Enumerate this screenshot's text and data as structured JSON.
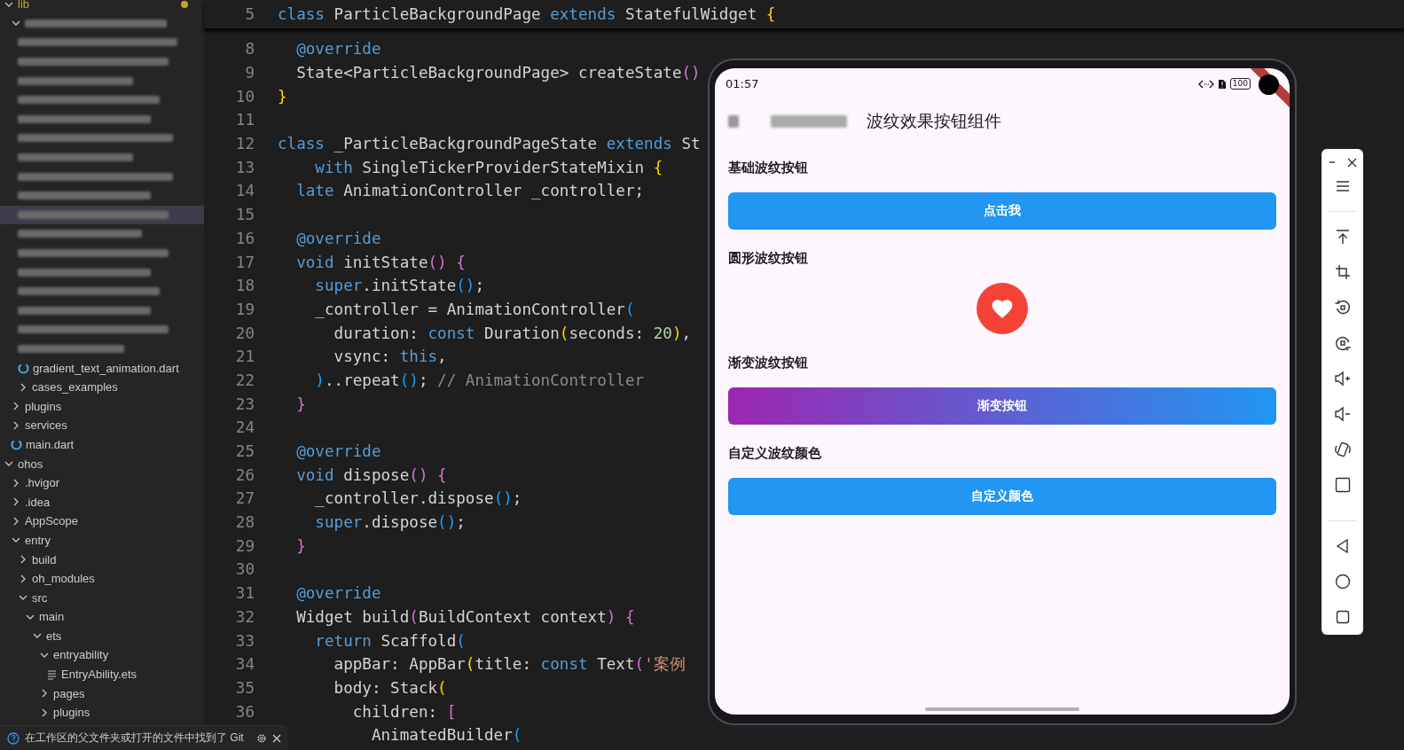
{
  "explorer": {
    "tree": [
      {
        "kind": "folder",
        "label": "lib",
        "expanded": true,
        "selected": false,
        "color": "#c9a22a",
        "children": [
          {
            "kind": "redacted",
            "expanded": true,
            "selected": false,
            "children": [
              {
                "kind": "redacted",
                "selected": false
              },
              {
                "kind": "redacted",
                "selected": false
              },
              {
                "kind": "redacted",
                "selected": false
              },
              {
                "kind": "redacted",
                "selected": false
              },
              {
                "kind": "redacted",
                "selected": false
              },
              {
                "kind": "redacted",
                "selected": false
              },
              {
                "kind": "redacted",
                "selected": false
              },
              {
                "kind": "redacted",
                "selected": false
              },
              {
                "kind": "redacted",
                "selected": false
              },
              {
                "kind": "redacted",
                "selected": true
              },
              {
                "kind": "redacted",
                "selected": false
              },
              {
                "kind": "redacted",
                "selected": false
              },
              {
                "kind": "redacted",
                "selected": false
              },
              {
                "kind": "redacted",
                "selected": false
              },
              {
                "kind": "redacted",
                "selected": false
              },
              {
                "kind": "redacted",
                "selected": false
              },
              {
                "kind": "redacted",
                "selected": false
              },
              {
                "kind": "dart",
                "label": "gradient_text_animation.dart",
                "selected": false
              },
              {
                "kind": "folder",
                "label": "cases_examples",
                "expanded": false,
                "selected": false
              }
            ]
          },
          {
            "kind": "folder",
            "label": "plugins",
            "expanded": false,
            "selected": false
          },
          {
            "kind": "folder",
            "label": "services",
            "expanded": false,
            "selected": false
          },
          {
            "kind": "dart",
            "label": "main.dart",
            "selected": false
          }
        ]
      },
      {
        "kind": "folder",
        "label": "ohos",
        "expanded": true,
        "selected": false,
        "children": [
          {
            "kind": "folder",
            "label": ".hvigor",
            "expanded": false,
            "selected": false
          },
          {
            "kind": "folder",
            "label": ".idea",
            "expanded": false,
            "selected": false
          },
          {
            "kind": "folder",
            "label": "AppScope",
            "expanded": false,
            "selected": false
          },
          {
            "kind": "folder",
            "label": "entry",
            "expanded": true,
            "selected": false,
            "children": [
              {
                "kind": "folder",
                "label": "build",
                "expanded": false,
                "selected": false
              },
              {
                "kind": "folder",
                "label": "oh_modules",
                "expanded": false,
                "selected": false
              },
              {
                "kind": "folder",
                "label": "src",
                "expanded": true,
                "selected": false,
                "children": [
                  {
                    "kind": "folder",
                    "label": "main",
                    "expanded": true,
                    "selected": false,
                    "children": [
                      {
                        "kind": "folder",
                        "label": "ets",
                        "expanded": true,
                        "selected": false,
                        "children": [
                          {
                            "kind": "folder",
                            "label": "entryability",
                            "expanded": true,
                            "selected": false,
                            "children": [
                              {
                                "kind": "text",
                                "label": "EntryAbility.ets",
                                "selected": false
                              }
                            ]
                          },
                          {
                            "kind": "folder",
                            "label": "pages",
                            "expanded": false,
                            "selected": false
                          },
                          {
                            "kind": "folder",
                            "label": "plugins",
                            "expanded": false,
                            "selected": false
                          }
                        ]
                      }
                    ]
                  }
                ]
              }
            ]
          }
        ]
      }
    ]
  },
  "notification": {
    "text": "在工作区的父文件夹或打开的文件中找到了 Git"
  },
  "editor": {
    "sticky": {
      "number": "5",
      "tokens": [
        {
          "kind": "kw",
          "text": "class"
        },
        {
          "kind": "id",
          "text": " ParticleBackgroundPage "
        },
        {
          "kind": "kw",
          "text": "extends"
        },
        {
          "kind": "id",
          "text": " StatefulWidget "
        },
        {
          "kind": "y",
          "text": "{"
        }
      ]
    },
    "lines": [
      {
        "number": "8",
        "tokens": [
          {
            "kind": "kw",
            "text": "  @override"
          }
        ]
      },
      {
        "number": "9",
        "tokens": [
          {
            "kind": "id",
            "text": "  State<ParticleBackgroundPage> createState"
          },
          {
            "kind": "p",
            "text": "()"
          }
        ]
      },
      {
        "number": "10",
        "tokens": [
          {
            "kind": "y",
            "text": "}"
          }
        ]
      },
      {
        "number": "11"
      },
      {
        "number": "12",
        "tokens": [
          {
            "kind": "kw",
            "text": "class"
          },
          {
            "kind": "id",
            "text": " _ParticleBackgroundPageState "
          },
          {
            "kind": "kw",
            "text": "extends"
          },
          {
            "kind": "id",
            "text": " St"
          }
        ]
      },
      {
        "number": "13",
        "tokens": [
          {
            "kind": "kw",
            "text": "    with"
          },
          {
            "kind": "id",
            "text": " SingleTickerProviderStateMixin "
          },
          {
            "kind": "y",
            "text": "{"
          }
        ]
      },
      {
        "number": "14",
        "tokens": [
          {
            "kind": "kw",
            "text": "  late"
          },
          {
            "kind": "id",
            "text": " AnimationController _controller;"
          }
        ]
      },
      {
        "number": "15"
      },
      {
        "number": "16",
        "tokens": [
          {
            "kind": "kw",
            "text": "  @override"
          }
        ]
      },
      {
        "number": "17",
        "tokens": [
          {
            "kind": "kw",
            "text": "  void"
          },
          {
            "kind": "id",
            "text": " initState"
          },
          {
            "kind": "p",
            "text": "()"
          },
          {
            "kind": "p",
            "text": " {"
          }
        ]
      },
      {
        "number": "18",
        "tokens": [
          {
            "kind": "kw",
            "text": "    super"
          },
          {
            "kind": "id",
            "text": ".initState"
          },
          {
            "kind": "b",
            "text": "()"
          },
          {
            "kind": "id",
            "text": ";"
          }
        ]
      },
      {
        "number": "19",
        "tokens": [
          {
            "kind": "id",
            "text": "    _controller = AnimationController"
          },
          {
            "kind": "b",
            "text": "("
          }
        ]
      },
      {
        "number": "20",
        "tokens": [
          {
            "kind": "id",
            "text": "      duration: "
          },
          {
            "kind": "kw",
            "text": "const"
          },
          {
            "kind": "id",
            "text": " Duration"
          },
          {
            "kind": "y",
            "text": "("
          },
          {
            "kind": "id",
            "text": "seconds: "
          },
          {
            "kind": "num",
            "text": "20"
          },
          {
            "kind": "y",
            "text": ")"
          },
          {
            "kind": "id",
            "text": ","
          }
        ]
      },
      {
        "number": "21",
        "tokens": [
          {
            "kind": "id",
            "text": "      vsync: "
          },
          {
            "kind": "kw",
            "text": "this"
          },
          {
            "kind": "id",
            "text": ","
          }
        ]
      },
      {
        "number": "22",
        "tokens": [
          {
            "kind": "b",
            "text": "    )"
          },
          {
            "kind": "id",
            "text": "..repeat"
          },
          {
            "kind": "b",
            "text": "()"
          },
          {
            "kind": "id",
            "text": "; "
          },
          {
            "kind": "cm",
            "text": "// AnimationController"
          }
        ]
      },
      {
        "number": "23",
        "tokens": [
          {
            "kind": "p",
            "text": "  }"
          }
        ]
      },
      {
        "number": "24"
      },
      {
        "number": "25",
        "tokens": [
          {
            "kind": "kw",
            "text": "  @override"
          }
        ]
      },
      {
        "number": "26",
        "tokens": [
          {
            "kind": "kw",
            "text": "  void"
          },
          {
            "kind": "id",
            "text": " dispose"
          },
          {
            "kind": "p",
            "text": "()"
          },
          {
            "kind": "p",
            "text": " {"
          }
        ]
      },
      {
        "number": "27",
        "tokens": [
          {
            "kind": "id",
            "text": "    _controller.dispose"
          },
          {
            "kind": "b",
            "text": "()"
          },
          {
            "kind": "id",
            "text": ";"
          }
        ]
      },
      {
        "number": "28",
        "tokens": [
          {
            "kind": "kw",
            "text": "    super"
          },
          {
            "kind": "id",
            "text": ".dispose"
          },
          {
            "kind": "b",
            "text": "()"
          },
          {
            "kind": "id",
            "text": ";"
          }
        ]
      },
      {
        "number": "29",
        "tokens": [
          {
            "kind": "p",
            "text": "  }"
          }
        ]
      },
      {
        "number": "30"
      },
      {
        "number": "31",
        "tokens": [
          {
            "kind": "kw",
            "text": "  @override"
          }
        ]
      },
      {
        "number": "32",
        "tokens": [
          {
            "kind": "id",
            "text": "  Widget build"
          },
          {
            "kind": "p",
            "text": "("
          },
          {
            "kind": "id",
            "text": "BuildContext context"
          },
          {
            "kind": "p",
            "text": ")"
          },
          {
            "kind": "p",
            "text": " {"
          }
        ]
      },
      {
        "number": "33",
        "tokens": [
          {
            "kind": "kw",
            "text": "    return"
          },
          {
            "kind": "id",
            "text": " Scaffold"
          },
          {
            "kind": "b",
            "text": "("
          }
        ]
      },
      {
        "number": "34",
        "tokens": [
          {
            "kind": "id",
            "text": "      appBar: AppBar"
          },
          {
            "kind": "y",
            "text": "("
          },
          {
            "kind": "id",
            "text": "title: "
          },
          {
            "kind": "kw",
            "text": "const"
          },
          {
            "kind": "id",
            "text": " Text"
          },
          {
            "kind": "p",
            "text": "("
          },
          {
            "kind": "str",
            "text": "'案例"
          }
        ]
      },
      {
        "number": "35",
        "tokens": [
          {
            "kind": "id",
            "text": "      body: Stack"
          },
          {
            "kind": "y",
            "text": "("
          }
        ]
      },
      {
        "number": "36",
        "tokens": [
          {
            "kind": "id",
            "text": "        children: "
          },
          {
            "kind": "p",
            "text": "["
          }
        ]
      },
      {
        "tokens": [
          {
            "kind": "id",
            "text": "          AnimatedBuilder"
          },
          {
            "kind": "b",
            "text": "("
          }
        ]
      }
    ]
  },
  "device": {
    "status_bar": {
      "time": "01:57",
      "battery": "100"
    },
    "app_bar": {
      "title": "波纹效果按钮组件"
    },
    "sections": [
      {
        "title": "基础波纹按钮",
        "button": {
          "kind": "filled",
          "label": "点击我"
        }
      },
      {
        "title": "圆形波纹按钮",
        "button": {
          "kind": "circle-icon"
        }
      },
      {
        "title": "渐变波纹按钮",
        "button": {
          "kind": "gradient",
          "label": "渐变按钮"
        }
      },
      {
        "title": "自定义波纹颜色",
        "button": {
          "kind": "filled",
          "label": "自定义颜色"
        }
      }
    ]
  }
}
